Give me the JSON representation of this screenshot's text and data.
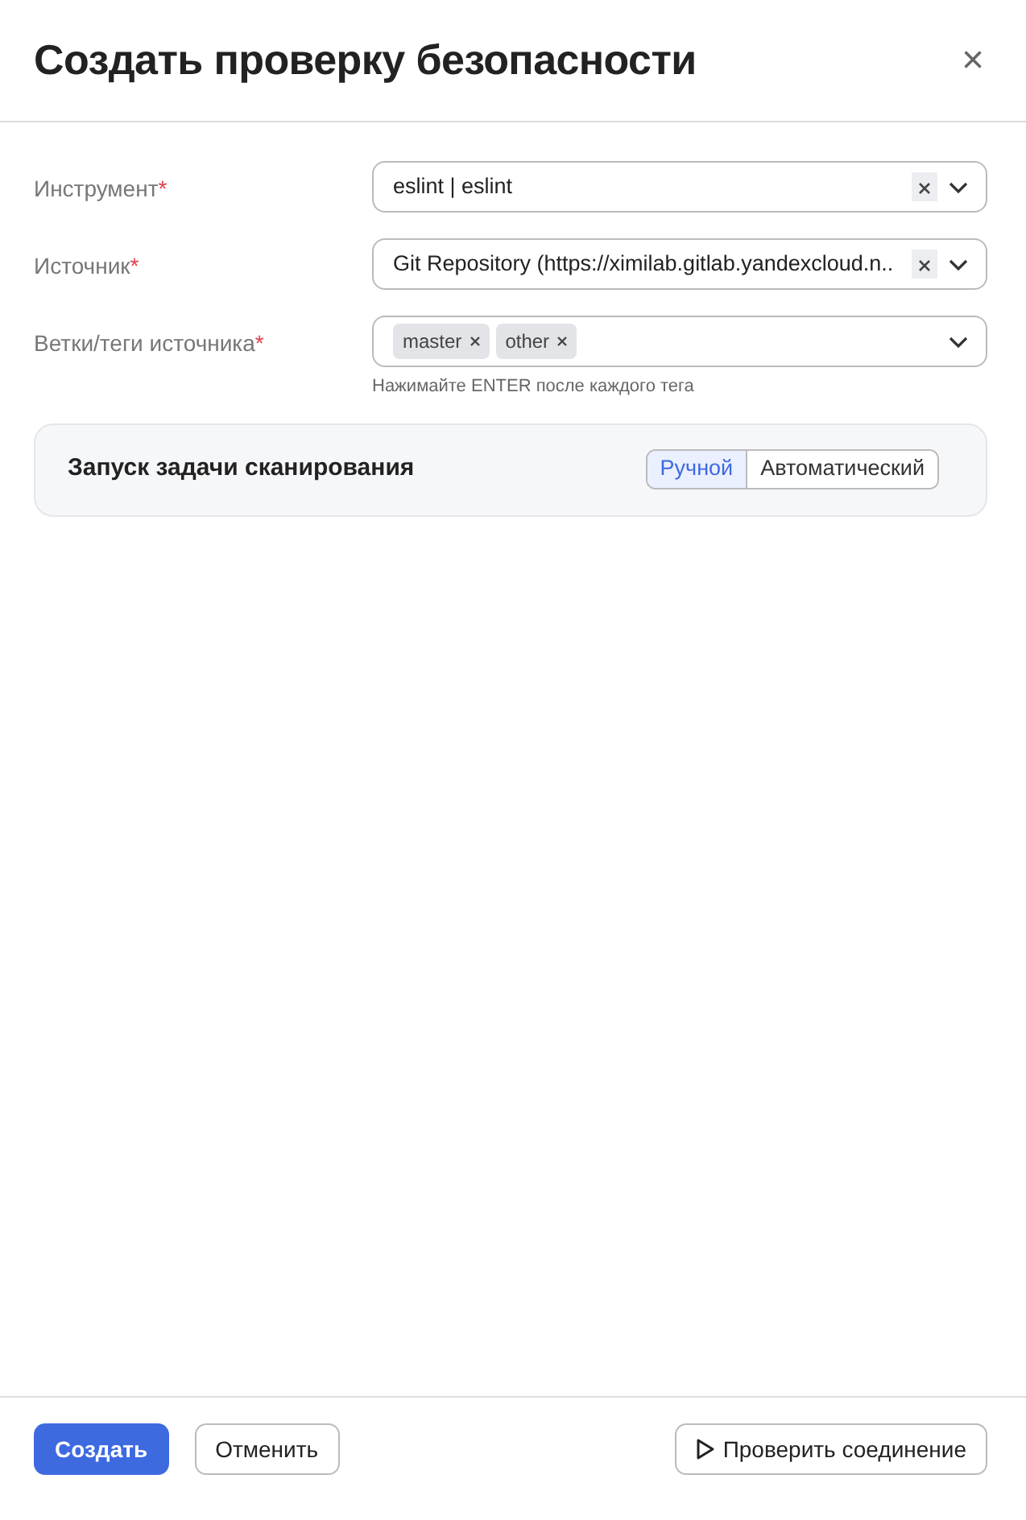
{
  "dialog": {
    "title": "Создать проверку безопасности",
    "close": "×"
  },
  "fields": [
    {
      "kind": "select",
      "label": "Инструмент",
      "required_mark": "*",
      "value": "eslint | eslint",
      "clearable": true
    },
    {
      "kind": "select",
      "label": "Источник",
      "required_mark": "*",
      "value": "Git Repository (https://ximilab.gitlab.yandexcloud.n..",
      "clearable": true
    },
    {
      "kind": "tags",
      "label": "Ветки/теги источника",
      "required_mark": "*",
      "tags": [
        "master",
        "other"
      ],
      "hint": "Нажимайте ENTER после каждого тега"
    }
  ],
  "scan_launch": {
    "label": "Запуск задачи сканирования",
    "options": [
      {
        "label": "Ручной",
        "selected": true
      },
      {
        "label": "Автоматический",
        "selected": false
      }
    ]
  },
  "footer": {
    "create": "Создать",
    "cancel": "Отменить",
    "check": "Проверить соединение"
  }
}
